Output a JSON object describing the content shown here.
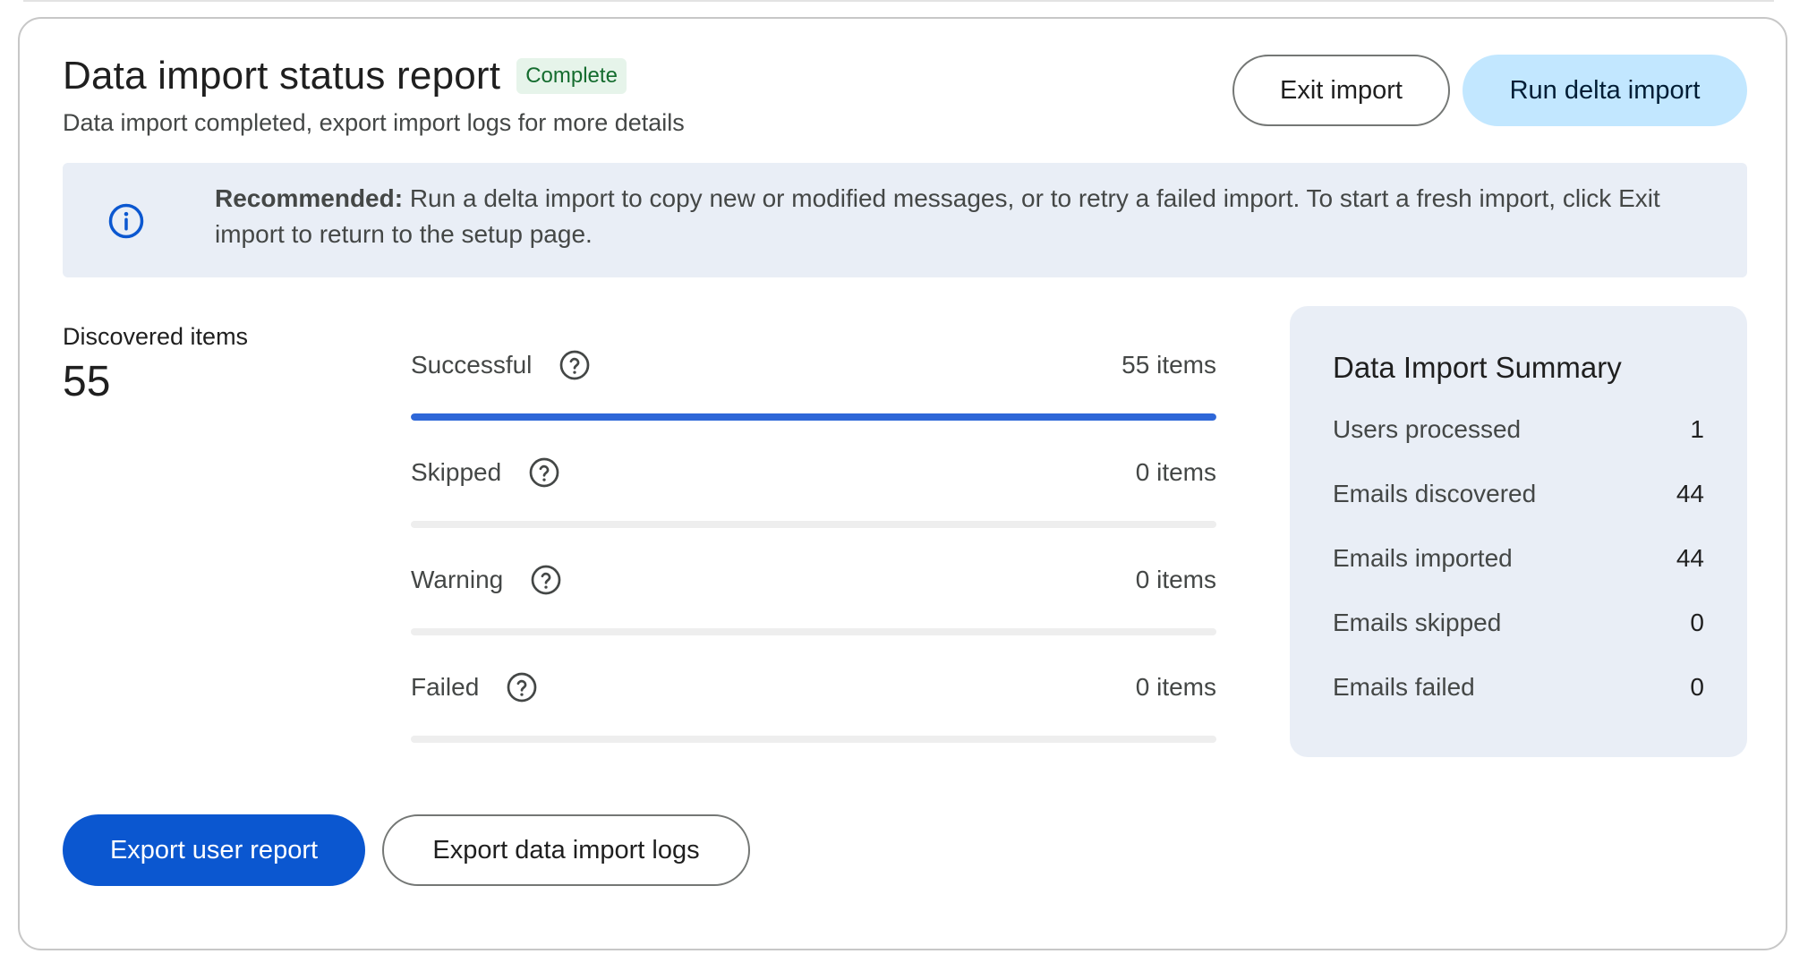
{
  "header": {
    "title": "Data import status report",
    "badge": "Complete",
    "subtitle": "Data import completed, export import logs for more details"
  },
  "actions": {
    "exit_label": "Exit import",
    "delta_label": "Run delta import"
  },
  "info": {
    "icon": "info-icon",
    "bold": "Recommended:",
    "text": " Run a delta import to copy new or modified messages, or to retry a failed import. To start a fresh import, click Exit import to return to the setup page."
  },
  "discovered": {
    "label": "Discovered items",
    "value": "55"
  },
  "stats": [
    {
      "label": "Successful",
      "count": "55 items",
      "progress": 1.0
    },
    {
      "label": "Skipped",
      "count": "0 items",
      "progress": 0
    },
    {
      "label": "Warning",
      "count": "0 items",
      "progress": 0
    },
    {
      "label": "Failed",
      "count": "0 items",
      "progress": 0
    }
  ],
  "summary": {
    "title": "Data Import Summary",
    "rows": [
      {
        "label": "Users processed",
        "value": "1"
      },
      {
        "label": "Emails discovered",
        "value": "44"
      },
      {
        "label": "Emails imported",
        "value": "44"
      },
      {
        "label": "Emails skipped",
        "value": "0"
      },
      {
        "label": "Emails failed",
        "value": "0"
      }
    ]
  },
  "footer": {
    "export_user_label": "Export user report",
    "export_logs_label": "Export data import logs"
  },
  "colors": {
    "primary": "#0b57d0",
    "tonal": "#c2e7ff",
    "progress": "#2e67d8",
    "badge_bg": "#e6f4ea",
    "badge_text": "#146c2e",
    "panel_bg": "#e9eef6"
  }
}
